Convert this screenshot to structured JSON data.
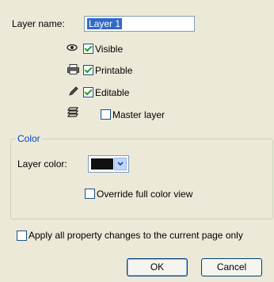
{
  "layer_name": {
    "label": "Layer name:",
    "value": "Layer 1"
  },
  "properties": [
    {
      "icon": "eye-icon",
      "label": "Visible",
      "checked": true
    },
    {
      "icon": "printer-icon",
      "label": "Printable",
      "checked": true
    },
    {
      "icon": "pencil-icon",
      "label": "Editable",
      "checked": true
    },
    {
      "icon": "master-layer-icon",
      "label": "Master layer",
      "checked": false
    }
  ],
  "color_group": {
    "title": "Color",
    "layer_color_label": "Layer color:",
    "layer_color_value": "#101010",
    "override_label": "Override full color view",
    "override_checked": false
  },
  "apply_all": {
    "label": "Apply all property changes to the current page only",
    "checked": false
  },
  "buttons": {
    "ok": "OK",
    "cancel": "Cancel"
  }
}
